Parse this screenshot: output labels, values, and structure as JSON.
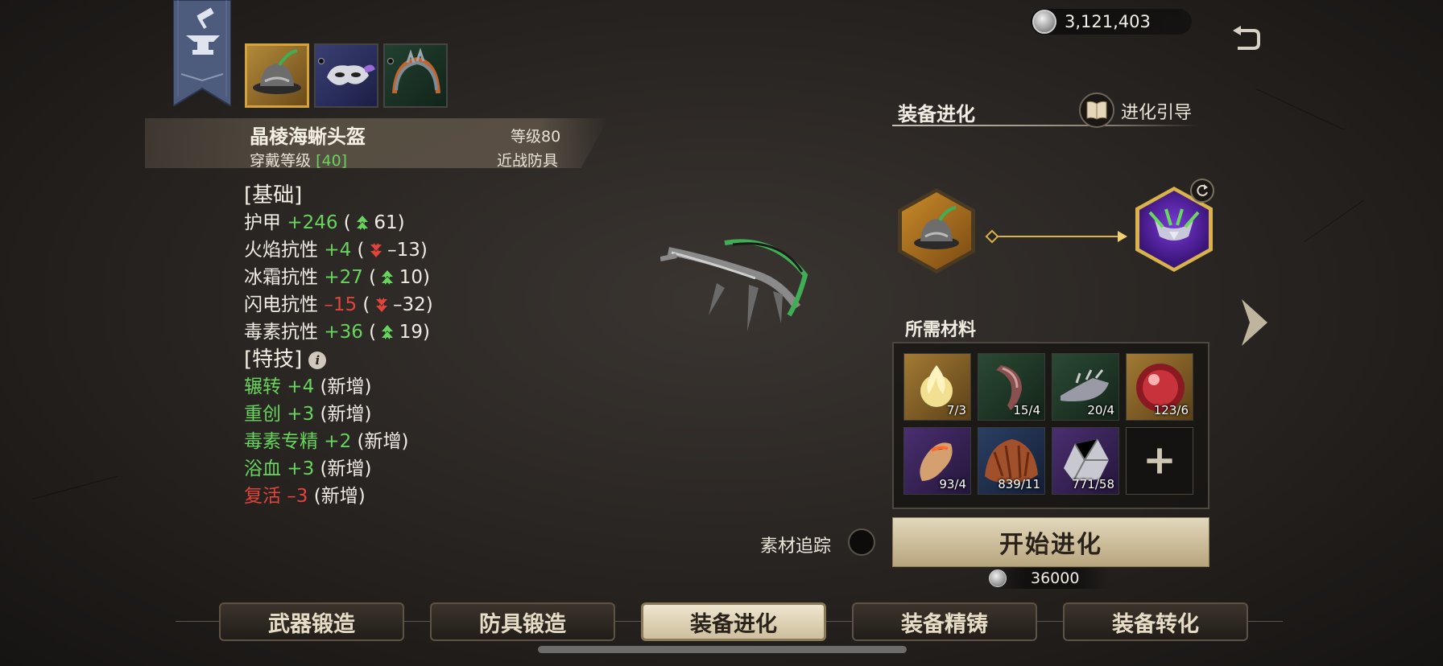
{
  "currency": {
    "amount": "3,121,403"
  },
  "equipment_slots": [
    {
      "name": "helmet",
      "selected": true
    },
    {
      "name": "mask",
      "selected": false
    },
    {
      "name": "crown",
      "selected": false
    }
  ],
  "item": {
    "name": "晶棱海蜥头盔",
    "level_label": "等级80",
    "wear_label": "穿戴等级",
    "wear_value": "[40]",
    "type": "近战防具"
  },
  "stats": {
    "basic_header": "[基础]",
    "basic": [
      {
        "name": "护甲",
        "value": "+246",
        "delta": "61",
        "dir": "up",
        "value_color": "#68d45d"
      },
      {
        "name": "火焰抗性",
        "value": "+4",
        "delta": "–13",
        "dir": "down",
        "value_color": "#68d45d"
      },
      {
        "name": "冰霜抗性",
        "value": "+27",
        "delta": "10",
        "dir": "up",
        "value_color": "#68d45d"
      },
      {
        "name": "闪电抗性",
        "value": "–15",
        "delta": "–32",
        "dir": "down",
        "value_color": "#e0443a"
      },
      {
        "name": "毒素抗性",
        "value": "+36",
        "delta": "19",
        "dir": "up",
        "value_color": "#68d45d"
      }
    ],
    "skill_header": "[特技]",
    "skills": [
      {
        "text": "辗转 +4",
        "note": "(新增)",
        "color": "#68d45d"
      },
      {
        "text": "重创 +3",
        "note": "(新增)",
        "color": "#68d45d"
      },
      {
        "text": "毒素专精 +2",
        "note": "(新增)",
        "color": "#68d45d"
      },
      {
        "text": "浴血 +3",
        "note": "(新增)",
        "color": "#68d45d"
      },
      {
        "text": "复活 –3",
        "note": "(新增)",
        "color": "#e0443a"
      }
    ]
  },
  "evolution": {
    "title": "装备进化",
    "guide_label": "进化引导",
    "materials_title": "所需材料",
    "materials": [
      {
        "icon": "flame-orb",
        "count": "7/3",
        "rarity": "gold"
      },
      {
        "icon": "claw",
        "count": "15/4",
        "rarity": "green"
      },
      {
        "icon": "spiked-boot",
        "count": "20/4",
        "rarity": "green"
      },
      {
        "icon": "red-gem",
        "count": "123/6",
        "rarity": "gold"
      },
      {
        "icon": "bone-crystal",
        "count": "93/4",
        "rarity": "purple"
      },
      {
        "icon": "fur-pelt",
        "count": "839/11",
        "rarity": "blue"
      },
      {
        "icon": "ore-chunk",
        "count": "771/58",
        "rarity": "purple"
      },
      {
        "icon": "plus",
        "count": "",
        "rarity": "empty"
      }
    ],
    "track_label": "素材追踪",
    "start_label": "开始进化",
    "cost": "36000"
  },
  "tabs": [
    {
      "label": "武器锻造",
      "active": false
    },
    {
      "label": "防具锻造",
      "active": false
    },
    {
      "label": "装备进化",
      "active": true
    },
    {
      "label": "装备精铸",
      "active": false
    },
    {
      "label": "装备转化",
      "active": false
    }
  ],
  "colors": {
    "positive": "#68d45d",
    "negative": "#e0443a",
    "accent_gold": "#d9b24a"
  }
}
